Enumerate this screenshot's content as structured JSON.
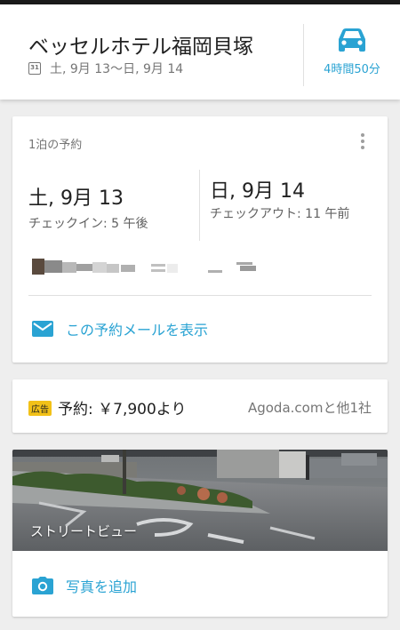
{
  "header": {
    "hotel_name": "ベッセルホテル福岡貝塚",
    "calendar_day": "31",
    "dates": "土, 9月 13〜日, 9月 14",
    "drive_time": "4時間50分"
  },
  "reservation_card": {
    "label": "1泊の予約",
    "checkin": {
      "date": "土, 9月 13",
      "time": "チェックイン: 5 午後"
    },
    "checkout": {
      "date": "日, 9月 14",
      "time": "チェックアウト: 11 午前"
    },
    "email_link": "この予約メールを表示"
  },
  "price_card": {
    "ad_badge": "広告",
    "price": "予約: ￥7,900より",
    "provider": "Agoda.comと他1社"
  },
  "photo_card": {
    "street_view_label": "ストリートビュー",
    "add_photo": "写真を追加"
  },
  "colors": {
    "accent": "#2aa3d3",
    "ad_badge": "#f2c118",
    "background": "#eeeeee"
  }
}
